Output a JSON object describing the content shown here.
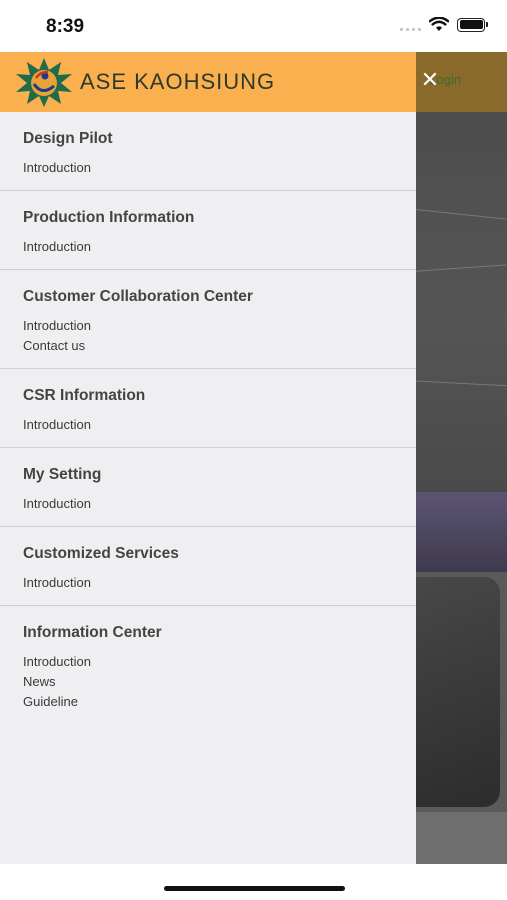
{
  "status_bar": {
    "time": "8:39"
  },
  "colors": {
    "drawer_header": "#fbb04f",
    "drawer_bg": "#efeff2"
  },
  "brand": {
    "name": "ASE KAOHSIUNG"
  },
  "background_page": {
    "login_label": "Login"
  },
  "menu": {
    "sections": [
      {
        "title": "Design Pilot",
        "items": [
          "Introduction"
        ]
      },
      {
        "title": "Production Information",
        "items": [
          "Introduction"
        ]
      },
      {
        "title": "Customer Collaboration Center",
        "items": [
          "Introduction",
          "Contact us"
        ]
      },
      {
        "title": "CSR Information",
        "items": [
          "Introduction"
        ]
      },
      {
        "title": "My Setting",
        "items": [
          "Introduction"
        ]
      },
      {
        "title": "Customized Services",
        "items": [
          "Introduction"
        ]
      },
      {
        "title": "Information Center",
        "items": [
          "Introduction",
          "News",
          "Guideline"
        ]
      }
    ]
  }
}
